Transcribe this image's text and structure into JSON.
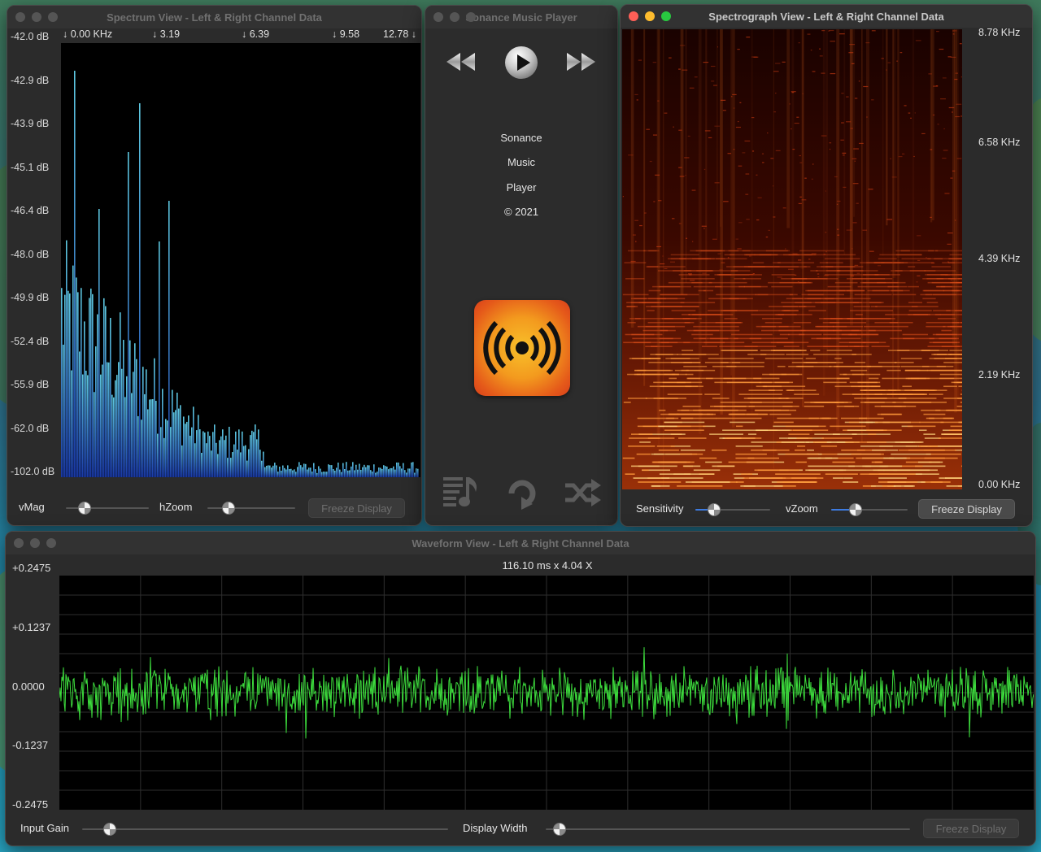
{
  "spectrum": {
    "title": "Spectrum View - Left & Right Channel Data",
    "db_labels": [
      "-42.0 dB",
      "-42.9 dB",
      "-43.9 dB",
      "-45.1 dB",
      "-46.4 dB",
      "-48.0 dB",
      "-49.9 dB",
      "-52.4 dB",
      "-55.9 dB",
      "-62.0 dB",
      "-102.0 dB"
    ],
    "khz_labels": [
      "↓ 0.00 KHz",
      "↓ 3.19",
      "↓ 6.39",
      "↓ 9.58",
      "12.78 ↓"
    ],
    "vmag_label": "vMag",
    "hzoom_label": "hZoom",
    "freeze_label": "Freeze Display",
    "vmag_value": 0.18,
    "hzoom_value": 0.2
  },
  "player": {
    "title": "Sonance Music Player",
    "lines": [
      "Sonance",
      "Music",
      "Player",
      "© 2021"
    ],
    "icons": [
      "rewind-icon",
      "play-icon",
      "fast-forward-icon",
      "playlist-icon",
      "repeat-icon",
      "shuffle-icon",
      "sonance-logo-icon"
    ]
  },
  "spectrograph": {
    "title": "Spectrograph View - Left & Right Channel Data",
    "freq_labels": [
      "8.78 KHz",
      "6.58 KHz",
      "4.39 KHz",
      "2.19 KHz",
      "0.00 KHz"
    ],
    "sensitivity_label": "Sensitivity",
    "vzoom_label": "vZoom",
    "freeze_label": "Freeze Display",
    "sensitivity_value": 0.2,
    "vzoom_value": 0.28
  },
  "waveform": {
    "title": "Waveform View - Left & Right Channel Data",
    "header": "116.10 ms x 4.04 X",
    "amp_labels": [
      "+0.2475",
      "+0.1237",
      "0.0000",
      "-0.1237",
      "-0.2475"
    ],
    "input_gain_label": "Input Gain",
    "display_width_label": "Display Width",
    "freeze_label": "Freeze Display",
    "input_gain_value": 0.06,
    "display_width_value": 0.02
  },
  "colors": {
    "spectrum_bar_top": "#5ec8e0",
    "spectrum_bar_bottom": "#1a3aa8",
    "waveform": "#3ddc3d",
    "grid": "#2e2e2e",
    "slider_fill": "#3d7be0"
  }
}
